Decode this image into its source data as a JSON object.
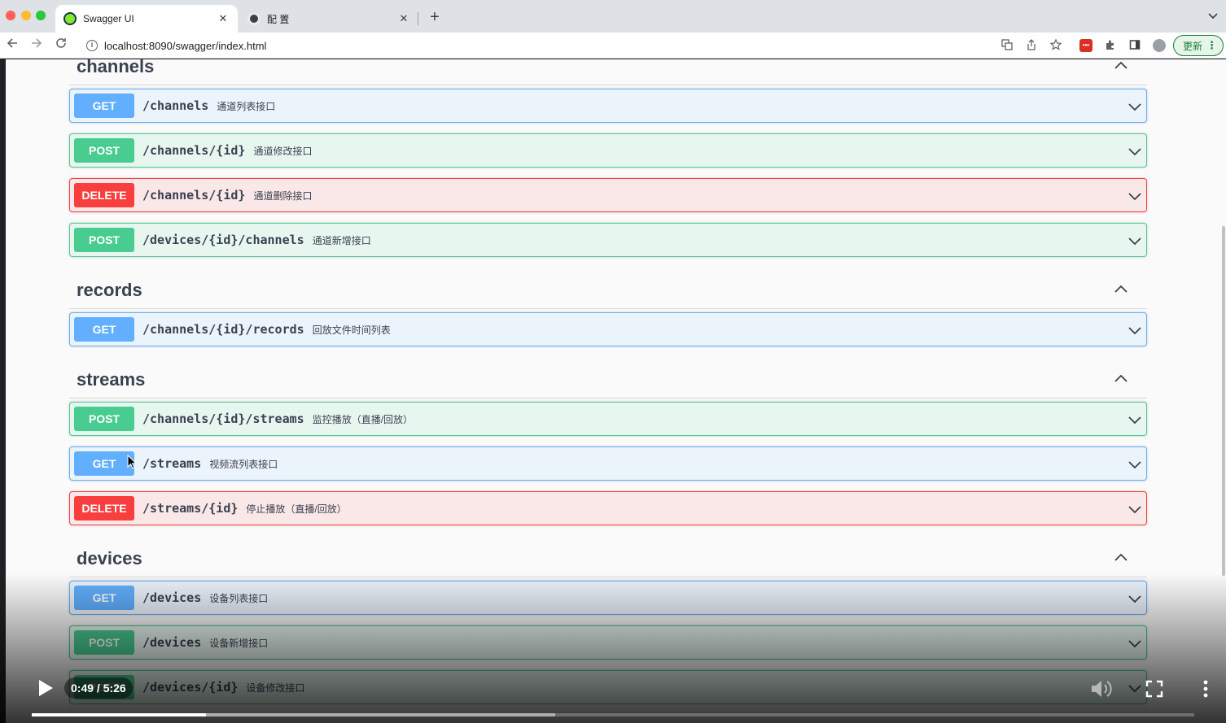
{
  "browser": {
    "tabs": [
      {
        "title": "Swagger UI",
        "active": true,
        "favicon": "swagger-favicon"
      },
      {
        "title": "配 置",
        "active": false,
        "favicon": "config-favicon"
      }
    ],
    "new_tab_label": "+",
    "close_label": "✕",
    "url": "localhost:8090/swagger/index.html",
    "update_label": "更新"
  },
  "sections": [
    {
      "name": "channels",
      "operations": [
        {
          "method": "GET",
          "path": "/channels",
          "summary": "通道列表接口"
        },
        {
          "method": "POST",
          "path": "/channels/{id}",
          "summary": "通道修改接口"
        },
        {
          "method": "DELETE",
          "path": "/channels/{id}",
          "summary": "通道删除接口"
        },
        {
          "method": "POST",
          "path": "/devices/{id}/channels",
          "summary": "通道新增接口"
        }
      ]
    },
    {
      "name": "records",
      "operations": [
        {
          "method": "GET",
          "path": "/channels/{id}/records",
          "summary": "回放文件时间列表"
        }
      ]
    },
    {
      "name": "streams",
      "operations": [
        {
          "method": "POST",
          "path": "/channels/{id}/streams",
          "summary": "监控播放（直播/回放）"
        },
        {
          "method": "GET",
          "path": "/streams",
          "summary": "视频流列表接口"
        },
        {
          "method": "DELETE",
          "path": "/streams/{id}",
          "summary": "停止播放（直播/回放）"
        }
      ]
    },
    {
      "name": "devices",
      "operations": [
        {
          "method": "GET",
          "path": "/devices",
          "summary": "设备列表接口"
        },
        {
          "method": "POST",
          "path": "/devices",
          "summary": "设备新增接口"
        },
        {
          "method": "POST",
          "path": "/devices/{id}",
          "summary": "设备修改接口"
        }
      ]
    }
  ],
  "colors": {
    "get": "#61affe",
    "post": "#49cc90",
    "delete": "#f93e3e"
  },
  "video": {
    "current_time": "0:49",
    "duration": "5:26",
    "time_display": "0:49 / 5:26",
    "played_fraction": 0.15,
    "buffered_fraction": 0.45
  }
}
